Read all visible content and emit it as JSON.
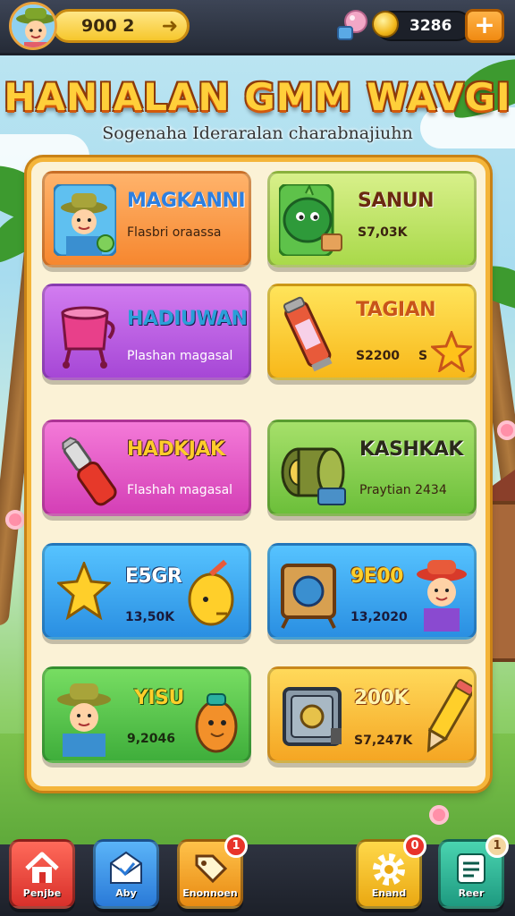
{
  "topbar": {
    "coins": "900 2",
    "currency": "3286"
  },
  "title": "HANIALAN GMM WAVGI",
  "subtitle": "Sogenaha Ideraralan charabnajiuhn",
  "cards": [
    {
      "name": "MAGKANNI",
      "desc": "Flasbri oraassa",
      "icon": "farmer-avatar-icon"
    },
    {
      "name": "SANUN",
      "desc": "S7,03K",
      "icon": "green-creature-icon"
    },
    {
      "name": "HADIUWAN",
      "desc": "Plashan magasal",
      "icon": "cauldron-icon"
    },
    {
      "name": "TAGIAN",
      "desc": "S2200",
      "desc2": "S",
      "icon": "potion-bottle-icon"
    },
    {
      "name": "HADKJAK",
      "desc": "Flashah magasal",
      "icon": "wrench-icon"
    },
    {
      "name": "KASHKAK",
      "desc": "Praytian 2434",
      "icon": "drum-icon"
    },
    {
      "name": "E5GR",
      "desc": "13,50K",
      "icon": "star-icon"
    },
    {
      "name": "9E00",
      "desc": "13,2020",
      "icon": "frame-icon"
    },
    {
      "name": "YISU",
      "desc": "9,2046",
      "icon": "fruit-creature-icon"
    },
    {
      "name": "200K",
      "desc": "S7,247K",
      "icon": "safe-icon"
    }
  ],
  "nav": [
    {
      "label": "Penjbe",
      "icon": "home-icon",
      "color": "#e8413d",
      "badge": ""
    },
    {
      "label": "Aby",
      "icon": "mail-icon",
      "color": "#2e8fe0",
      "badge": ""
    },
    {
      "label": "Enonnoen",
      "icon": "tag-icon",
      "color": "#f2a21c",
      "badge": "1"
    },
    {
      "label": "Enand",
      "icon": "gear-icon",
      "color": "#f4b818",
      "badge": "0"
    },
    {
      "label": "Reer",
      "icon": "list-icon",
      "color": "#2fae8f",
      "badge": "1"
    }
  ]
}
